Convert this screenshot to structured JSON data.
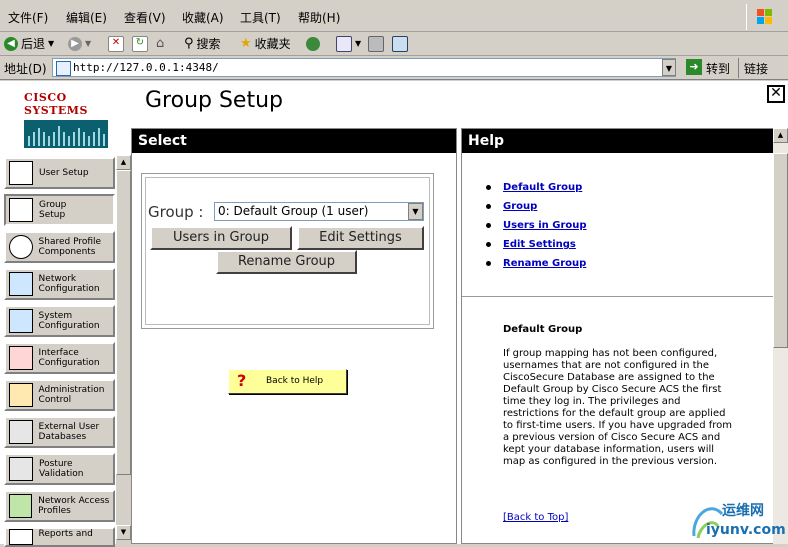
{
  "menubar": {
    "items": [
      "文件(F)",
      "编辑(E)",
      "查看(V)",
      "收藏(A)",
      "工具(T)",
      "帮助(H)"
    ]
  },
  "toolbar": {
    "back_label": "后退",
    "search_label": "搜索",
    "favorites_label": "收藏夹"
  },
  "address": {
    "label": "地址(D)",
    "url": "http://127.0.0.1:4348/",
    "go_label": "转到",
    "links_label": "链接"
  },
  "header": {
    "brand": "Cisco Systems",
    "title": "Group Setup"
  },
  "nav": {
    "items": [
      {
        "label": "User Setup"
      },
      {
        "label": "Group Setup"
      },
      {
        "label": "Shared Profile Components"
      },
      {
        "label": "Network Configuration"
      },
      {
        "label": "System Configuration"
      },
      {
        "label": "Interface Configuration"
      },
      {
        "label": "Administration Control"
      },
      {
        "label": "External User Databases"
      },
      {
        "label": "Posture Validation"
      },
      {
        "label": "Network Access Profiles"
      },
      {
        "label": "Reports and"
      }
    ]
  },
  "select_panel": {
    "title": "Select",
    "group_label": "Group :",
    "group_value": "0: Default Group (1 user)",
    "users_in_group": "Users in Group",
    "edit_settings": "Edit Settings",
    "rename_group": "Rename Group",
    "back_to_help": "Back to Help"
  },
  "help_panel": {
    "title": "Help",
    "links": [
      "Default Group",
      "Group",
      "Users in Group",
      "Edit Settings",
      "Rename Group"
    ],
    "section_heading": "Default Group",
    "section_body": "If group mapping has not been configured, usernames that are not configured in the CiscoSecure Database are assigned to the Default Group by Cisco Secure ACS the first time they log in. The privileges and restrictions for the default group are applied to first-time users. If you have upgraded from a previous version of Cisco Secure ACS and kept your database information, users will map as configured in the previous version.",
    "back_to_top": "[Back to Top]"
  },
  "watermark": {
    "cn": "运维网",
    "domain": "iyunv.com"
  },
  "colors": {
    "brand_red": "#b00000",
    "panel_header_bg": "#000000",
    "link_blue": "#0000c0",
    "back_help_bg": "#ffff99"
  }
}
